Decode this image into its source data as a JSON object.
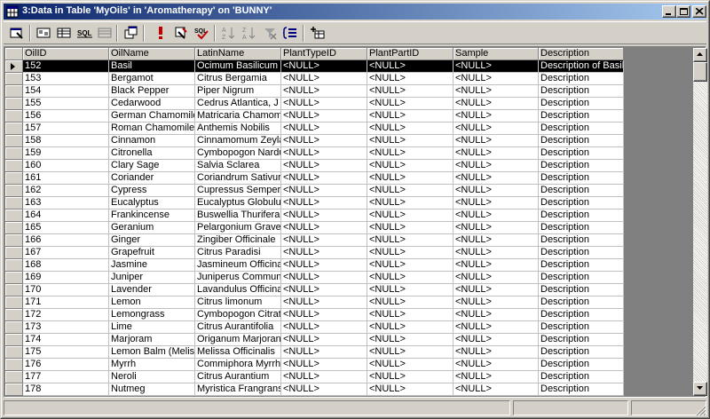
{
  "window": {
    "title": "3:Data in Table 'MyOils' in 'Aromatherapy' on 'BUNNY'"
  },
  "titlebar_buttons": [
    {
      "name": "minimize-button",
      "icon": "minimize-icon"
    },
    {
      "name": "maximize-button",
      "icon": "maximize-icon"
    },
    {
      "name": "close-button",
      "icon": "close-icon"
    }
  ],
  "toolbar": [
    {
      "name": "properties-button",
      "icon": "properties-icon"
    },
    {
      "name": "show-diagram-pane-button",
      "icon": "diagram-pane-icon"
    },
    {
      "name": "show-grid-pane-button",
      "icon": "grid-pane-icon"
    },
    {
      "name": "show-sql-pane-button",
      "icon": "sql-pane-icon",
      "label": "SQL"
    },
    {
      "name": "show-results-pane-button",
      "icon": "results-pane-icon"
    },
    {
      "name": "change-query-type-button",
      "icon": "query-type-icon"
    },
    {
      "name": "run-button",
      "icon": "exclamation-icon"
    },
    {
      "name": "verify-sql-button",
      "icon": "verify-sql-icon"
    },
    {
      "name": "remove-filter-button",
      "icon": "remove-filter-icon"
    },
    {
      "name": "sort-ascending-button",
      "icon": "sort-ascending-icon"
    },
    {
      "name": "sort-descending-button",
      "icon": "sort-descending-icon"
    },
    {
      "name": "remove-filter-x-button",
      "icon": "filter-x-icon"
    },
    {
      "name": "group-by-button",
      "icon": "group-by-icon"
    },
    {
      "name": "add-table-button",
      "icon": "add-table-icon"
    }
  ],
  "grid": {
    "columns": [
      "OilID",
      "OilName",
      "LatinName",
      "PlantTypeID",
      "PlantPartID",
      "Sample",
      "Description"
    ],
    "selected_row": 0,
    "rows": [
      [
        "152",
        "Basil",
        "Ocimum Basilicum",
        "<NULL>",
        "<NULL>",
        "<NULL>",
        "Description of Basil"
      ],
      [
        "153",
        "Bergamot",
        "Citrus Bergamia",
        "<NULL>",
        "<NULL>",
        "<NULL>",
        "Description"
      ],
      [
        "154",
        "Black Pepper",
        "Piper Nigrum",
        "<NULL>",
        "<NULL>",
        "<NULL>",
        "Description"
      ],
      [
        "155",
        "Cedarwood",
        "Cedrus Atlantica, J",
        "<NULL>",
        "<NULL>",
        "<NULL>",
        "Description"
      ],
      [
        "156",
        "German Chamomile",
        "Matricaria Chamom",
        "<NULL>",
        "<NULL>",
        "<NULL>",
        "Description"
      ],
      [
        "157",
        "Roman Chamomile",
        "Anthemis Nobilis",
        "<NULL>",
        "<NULL>",
        "<NULL>",
        "Description"
      ],
      [
        "158",
        "Cinnamon",
        "Cinnamomum Zeyla",
        "<NULL>",
        "<NULL>",
        "<NULL>",
        "Description"
      ],
      [
        "159",
        "Citronella",
        "Cymbopogon Nardu",
        "<NULL>",
        "<NULL>",
        "<NULL>",
        "Description"
      ],
      [
        "160",
        "Clary Sage",
        "Salvia Sclarea",
        "<NULL>",
        "<NULL>",
        "<NULL>",
        "Description"
      ],
      [
        "161",
        "Coriander",
        "Coriandrum Sativur",
        "<NULL>",
        "<NULL>",
        "<NULL>",
        "Description"
      ],
      [
        "162",
        "Cypress",
        "Cupressus Semper",
        "<NULL>",
        "<NULL>",
        "<NULL>",
        "Description"
      ],
      [
        "163",
        "Eucalyptus",
        "Eucalyptus Globulu",
        "<NULL>",
        "<NULL>",
        "<NULL>",
        "Description"
      ],
      [
        "164",
        "Frankincense",
        "Buswellia Thurifera",
        "<NULL>",
        "<NULL>",
        "<NULL>",
        "Description"
      ],
      [
        "165",
        "Geranium",
        "Pelargonium Grave",
        "<NULL>",
        "<NULL>",
        "<NULL>",
        "Description"
      ],
      [
        "166",
        "Ginger",
        "Zingiber Officinale",
        "<NULL>",
        "<NULL>",
        "<NULL>",
        "Description"
      ],
      [
        "167",
        "Grapefruit",
        "Citrus Paradisi",
        "<NULL>",
        "<NULL>",
        "<NULL>",
        "Description"
      ],
      [
        "168",
        "Jasmine",
        "Jasmineum Officina",
        "<NULL>",
        "<NULL>",
        "<NULL>",
        "Description"
      ],
      [
        "169",
        "Juniper",
        "Juniperus Communi",
        "<NULL>",
        "<NULL>",
        "<NULL>",
        "Description"
      ],
      [
        "170",
        "Lavender",
        "Lavandulus Officina",
        "<NULL>",
        "<NULL>",
        "<NULL>",
        "Description"
      ],
      [
        "171",
        "Lemon",
        "Citrus limonum",
        "<NULL>",
        "<NULL>",
        "<NULL>",
        "Description"
      ],
      [
        "172",
        "Lemongrass",
        "Cymbopogon Citrat",
        "<NULL>",
        "<NULL>",
        "<NULL>",
        "Description"
      ],
      [
        "173",
        "Lime",
        "Citrus Aurantifolia",
        "<NULL>",
        "<NULL>",
        "<NULL>",
        "Description"
      ],
      [
        "174",
        "Marjoram",
        "Origanum Marjoran",
        "<NULL>",
        "<NULL>",
        "<NULL>",
        "Description"
      ],
      [
        "175",
        "Lemon Balm (Melissa",
        "Melissa Officinalis",
        "<NULL>",
        "<NULL>",
        "<NULL>",
        "Description"
      ],
      [
        "176",
        "Myrrh",
        "Commiphora Myrrh",
        "<NULL>",
        "<NULL>",
        "<NULL>",
        "Description"
      ],
      [
        "177",
        "Neroli",
        "Citrus Aurantium",
        "<NULL>",
        "<NULL>",
        "<NULL>",
        "Description"
      ],
      [
        "178",
        "Nutmeg",
        "Myristica Frangrans",
        "<NULL>",
        "<NULL>",
        "<NULL>",
        "Description"
      ]
    ]
  },
  "colors": {
    "title_gradient_start": "#0a246a",
    "title_gradient_end": "#a6caf0",
    "chrome": "#d4d0c8",
    "selected_row_bg": "#000000",
    "selected_row_fg": "#ffffff"
  }
}
